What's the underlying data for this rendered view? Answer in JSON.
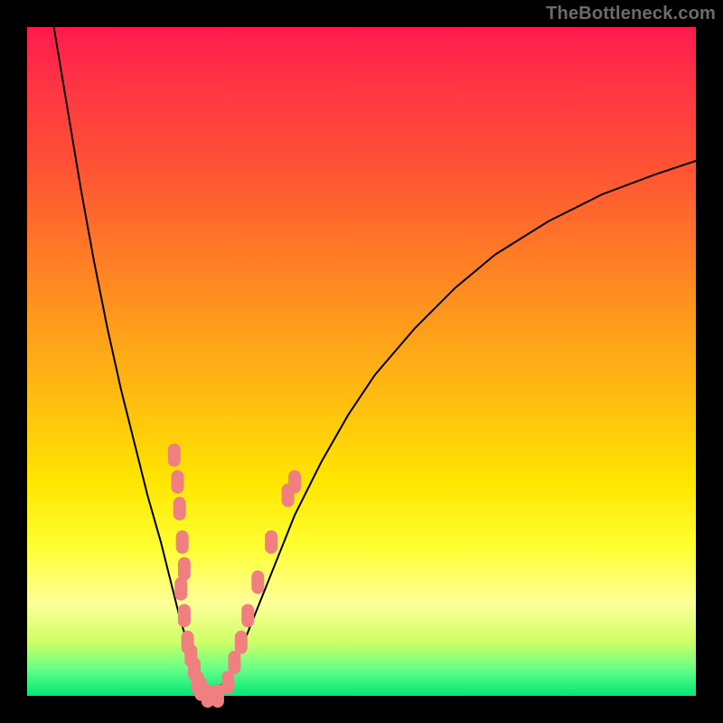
{
  "watermark": "TheBottleneck.com",
  "colors": {
    "background": "#000000",
    "gradient_top": "#ff1a4d",
    "gradient_bottom": "#00e676",
    "curve_stroke": "#000000",
    "scatter_fill": "#f08080",
    "watermark_text": "#6b6b6b"
  },
  "chart_data": {
    "type": "line",
    "title": "",
    "xlabel": "",
    "ylabel": "",
    "xlim": [
      0,
      100
    ],
    "ylim": [
      0,
      100
    ],
    "grid": false,
    "legend": false,
    "series": [
      {
        "name": "left-curve",
        "x": [
          4,
          6,
          8,
          10,
          12,
          14,
          16,
          18,
          20,
          22,
          23,
          24,
          25,
          26,
          27,
          28
        ],
        "y": [
          100,
          88,
          76,
          65,
          55,
          46,
          38,
          30,
          23,
          15,
          11,
          8,
          5,
          3,
          1,
          0
        ]
      },
      {
        "name": "right-curve",
        "x": [
          28,
          30,
          32,
          34,
          36,
          38,
          40,
          44,
          48,
          52,
          58,
          64,
          70,
          78,
          86,
          94,
          100
        ],
        "y": [
          0,
          3,
          7,
          12,
          17,
          22,
          27,
          35,
          42,
          48,
          55,
          61,
          66,
          71,
          75,
          78,
          80
        ]
      }
    ],
    "scatter_points": {
      "name": "highlighted-points",
      "description": "Pink markers along both curves in lower band (~y 0–40)",
      "points": [
        {
          "x": 23,
          "y": 16
        },
        {
          "x": 23.5,
          "y": 12
        },
        {
          "x": 24,
          "y": 8
        },
        {
          "x": 24.5,
          "y": 6
        },
        {
          "x": 25,
          "y": 4
        },
        {
          "x": 25.5,
          "y": 2
        },
        {
          "x": 26,
          "y": 1
        },
        {
          "x": 27,
          "y": 0
        },
        {
          "x": 28.5,
          "y": 0
        },
        {
          "x": 30,
          "y": 2
        },
        {
          "x": 31,
          "y": 5
        },
        {
          "x": 32,
          "y": 8
        },
        {
          "x": 33,
          "y": 12
        },
        {
          "x": 34.5,
          "y": 17
        },
        {
          "x": 36.5,
          "y": 23
        },
        {
          "x": 39,
          "y": 30
        },
        {
          "x": 40,
          "y": 32
        },
        {
          "x": 22,
          "y": 36
        },
        {
          "x": 22.5,
          "y": 32
        },
        {
          "x": 22.8,
          "y": 28
        },
        {
          "x": 23.2,
          "y": 23
        },
        {
          "x": 23.5,
          "y": 19
        }
      ]
    }
  }
}
